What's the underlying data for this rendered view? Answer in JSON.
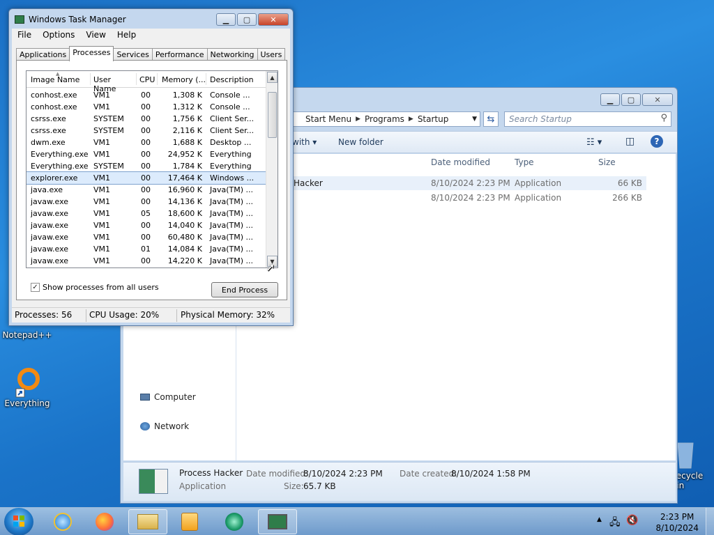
{
  "desktop": {
    "icons": [
      {
        "name": "notepadpp",
        "label": "Notepad++"
      },
      {
        "name": "everything",
        "label": "Everything"
      },
      {
        "name": "recycle",
        "label": "Recycle Bin"
      }
    ]
  },
  "explorer": {
    "breadcrumb": [
      "Start Menu",
      "Programs",
      "Startup"
    ],
    "search_placeholder": "Search Startup",
    "toolbar": {
      "open_with": "with",
      "new_folder": "New folder"
    },
    "nav": {
      "computer": "Computer",
      "network": "Network"
    },
    "columns": {
      "modified": "Date modified",
      "type": "Type",
      "size": "Size"
    },
    "rows": [
      {
        "name": "Hacker",
        "modified": "8/10/2024 2:23 PM",
        "type": "Application",
        "size": "66 KB"
      },
      {
        "name": "",
        "modified": "8/10/2024 2:23 PM",
        "type": "Application",
        "size": "266 KB"
      }
    ],
    "details": {
      "name": "Process Hacker",
      "kind": "Application",
      "modified_label": "Date modified:",
      "modified": "8/10/2024 2:23 PM",
      "created_label": "Date created:",
      "created": "8/10/2024 1:58 PM",
      "size_label": "Size:",
      "size": "65.7 KB"
    }
  },
  "taskmgr": {
    "title": "Windows Task Manager",
    "menu": [
      "File",
      "Options",
      "View",
      "Help"
    ],
    "tabs": [
      "Applications",
      "Processes",
      "Services",
      "Performance",
      "Networking",
      "Users"
    ],
    "active_tab": "Processes",
    "columns": [
      "Image Name",
      "User Name",
      "CPU",
      "Memory (...",
      "Description"
    ],
    "processes": [
      {
        "image": "conhost.exe",
        "user": "VM1",
        "cpu": "00",
        "mem": "1,308 K",
        "desc": "Console ..."
      },
      {
        "image": "conhost.exe",
        "user": "VM1",
        "cpu": "00",
        "mem": "1,312 K",
        "desc": "Console ..."
      },
      {
        "image": "csrss.exe",
        "user": "SYSTEM",
        "cpu": "00",
        "mem": "1,756 K",
        "desc": "Client Ser..."
      },
      {
        "image": "csrss.exe",
        "user": "SYSTEM",
        "cpu": "00",
        "mem": "2,116 K",
        "desc": "Client Ser..."
      },
      {
        "image": "dwm.exe",
        "user": "VM1",
        "cpu": "00",
        "mem": "1,688 K",
        "desc": "Desktop ..."
      },
      {
        "image": "Everything.exe",
        "user": "VM1",
        "cpu": "00",
        "mem": "24,952 K",
        "desc": "Everything"
      },
      {
        "image": "Everything.exe",
        "user": "SYSTEM",
        "cpu": "00",
        "mem": "1,784 K",
        "desc": "Everything"
      },
      {
        "image": "explorer.exe",
        "user": "VM1",
        "cpu": "00",
        "mem": "17,464 K",
        "desc": "Windows ..."
      },
      {
        "image": "java.exe",
        "user": "VM1",
        "cpu": "00",
        "mem": "16,960 K",
        "desc": "Java(TM) ..."
      },
      {
        "image": "javaw.exe",
        "user": "VM1",
        "cpu": "00",
        "mem": "14,136 K",
        "desc": "Java(TM) ..."
      },
      {
        "image": "javaw.exe",
        "user": "VM1",
        "cpu": "05",
        "mem": "18,600 K",
        "desc": "Java(TM) ..."
      },
      {
        "image": "javaw.exe",
        "user": "VM1",
        "cpu": "00",
        "mem": "14,040 K",
        "desc": "Java(TM) ..."
      },
      {
        "image": "javaw.exe",
        "user": "VM1",
        "cpu": "00",
        "mem": "60,480 K",
        "desc": "Java(TM) ..."
      },
      {
        "image": "javaw.exe",
        "user": "VM1",
        "cpu": "01",
        "mem": "14,084 K",
        "desc": "Java(TM) ..."
      },
      {
        "image": "javaw.exe",
        "user": "VM1",
        "cpu": "00",
        "mem": "14,220 K",
        "desc": "Java(TM) ..."
      }
    ],
    "selected_image": "explorer.exe",
    "show_all_label": "Show processes from all users",
    "show_all_checked": true,
    "end_process_label": "End Process",
    "status": {
      "processes": "Processes: 56",
      "cpu": "CPU Usage: 20%",
      "memory": "Physical Memory: 32%"
    }
  },
  "taskbar": {
    "time": "2:23 PM",
    "date": "8/10/2024"
  }
}
